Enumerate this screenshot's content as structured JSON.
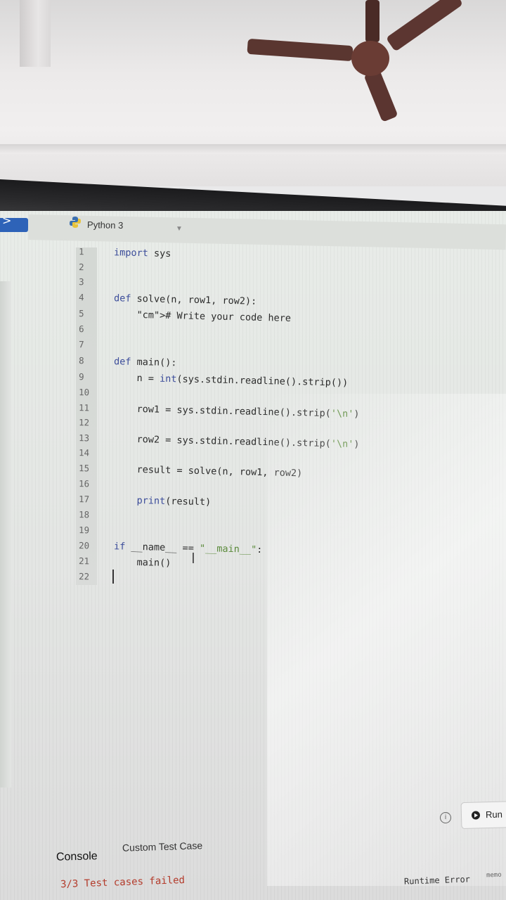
{
  "language": {
    "label": "Python 3",
    "icon": "python-icon"
  },
  "editor": {
    "lines": [
      {
        "n": "1",
        "code": "import sys"
      },
      {
        "n": "2",
        "code": ""
      },
      {
        "n": "3",
        "code": ""
      },
      {
        "n": "4",
        "code": "def solve(n, row1, row2):"
      },
      {
        "n": "5",
        "code": "    # Write your code here"
      },
      {
        "n": "6",
        "code": ""
      },
      {
        "n": "7",
        "code": ""
      },
      {
        "n": "8",
        "code": "def main():"
      },
      {
        "n": "9",
        "code": "    n = int(sys.stdin.readline().strip())"
      },
      {
        "n": "10",
        "code": ""
      },
      {
        "n": "11",
        "code": "    row1 = sys.stdin.readline().strip('\\n')"
      },
      {
        "n": "12",
        "code": ""
      },
      {
        "n": "13",
        "code": "    row2 = sys.stdin.readline().strip('\\n')"
      },
      {
        "n": "14",
        "code": ""
      },
      {
        "n": "15",
        "code": "    result = solve(n, row1, row2)"
      },
      {
        "n": "16",
        "code": ""
      },
      {
        "n": "17",
        "code": "    print(result)"
      },
      {
        "n": "18",
        "code": ""
      },
      {
        "n": "19",
        "code": ""
      },
      {
        "n": "20",
        "code": "if __name__ == \"__main__\":"
      },
      {
        "n": "21",
        "code": "    main()"
      },
      {
        "n": "22",
        "code": ""
      }
    ]
  },
  "toolbar": {
    "run_label": "Run",
    "info_icon": "info-icon"
  },
  "tabs": {
    "console": "Console",
    "custom_test_case": "Custom Test Case"
  },
  "result": {
    "summary": "3/3 Test cases failed",
    "status": "Runtime Error",
    "memo": "memo"
  },
  "colors": {
    "accent": "#2e63b8",
    "error": "#b33a2a",
    "keyword": "#3b4c9a"
  }
}
